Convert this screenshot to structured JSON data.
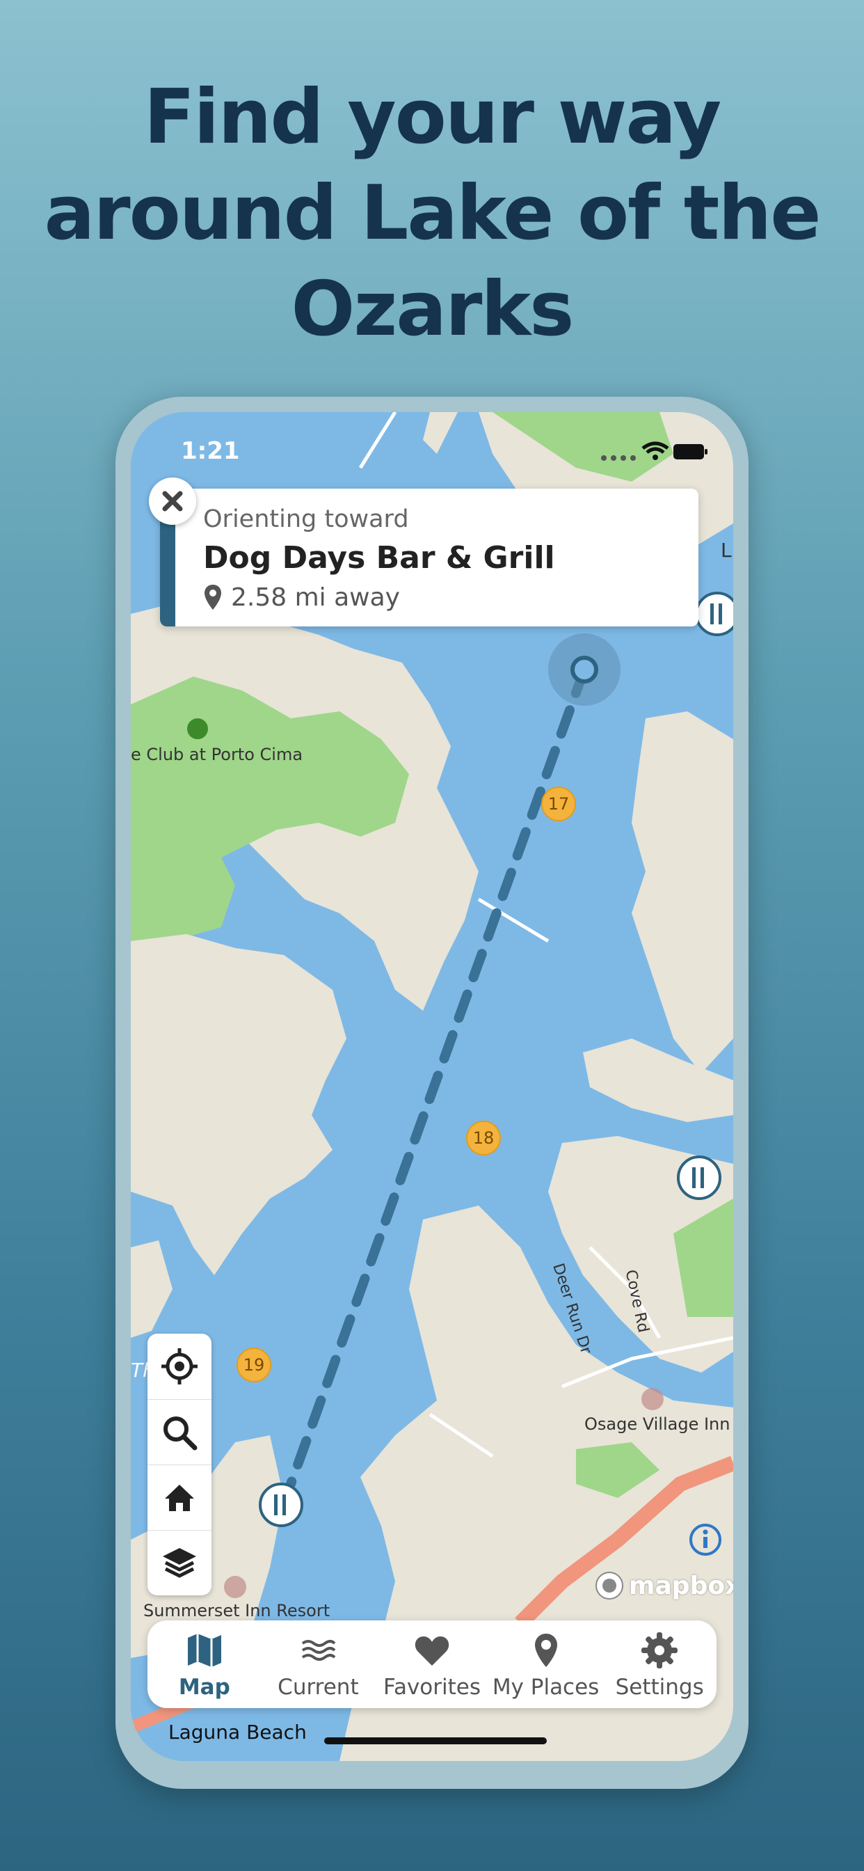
{
  "headline": {
    "line1": "Find your way",
    "line2": "around Lake of the",
    "line3": "Ozarks"
  },
  "status_bar": {
    "time": "1:21"
  },
  "orientation_banner": {
    "subtitle": "Orienting toward",
    "title": "Dog Days Bar & Grill",
    "distance": "2.58 mi away"
  },
  "map": {
    "labels": {
      "porto_cima": "e Club at Porto Cima",
      "deer_run": "Deer Run Dr",
      "cove_rd": "Cove Rd",
      "osage_inn": "Osage Village Inn",
      "summerset": "Summerset Inn Resort",
      "laguna": "Laguna Beach",
      "edge_l": "L",
      "edge_th": "Th"
    },
    "mile_markers": [
      "17",
      "18",
      "19"
    ],
    "attribution": "mapbox",
    "colors": {
      "water": "#7eb9e6",
      "land": "#e8e4d8",
      "park": "#9fd68a",
      "route": "#3a7196",
      "marker": "#f3b33d"
    }
  },
  "map_tools": [
    {
      "name": "locate",
      "icon": "crosshair-icon"
    },
    {
      "name": "search",
      "icon": "search-icon"
    },
    {
      "name": "home",
      "icon": "home-icon"
    },
    {
      "name": "layers",
      "icon": "layers-icon"
    }
  ],
  "tabbar": {
    "active": "Map",
    "tabs": [
      {
        "label": "Map",
        "icon": "map-icon"
      },
      {
        "label": "Current",
        "icon": "waves-icon"
      },
      {
        "label": "Favorites",
        "icon": "heart-icon"
      },
      {
        "label": "My Places",
        "icon": "pin-icon"
      },
      {
        "label": "Settings",
        "icon": "gear-icon"
      }
    ]
  }
}
